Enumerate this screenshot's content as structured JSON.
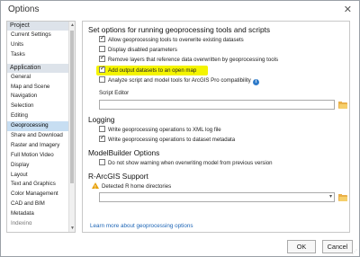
{
  "window": {
    "title": "Options",
    "close_glyph": "✕"
  },
  "sidebar": {
    "project_header": "Project",
    "project_items": [
      "Current Settings",
      "Units",
      "Tasks"
    ],
    "application_header": "Application",
    "application_items": [
      "General",
      "Map and Scene",
      "Navigation",
      "Selection",
      "Editing",
      "Geoprocessing",
      "Share and Download",
      "Raster and Imagery",
      "Full Motion Video",
      "Display",
      "Layout",
      "Text and Graphics",
      "Color Management",
      "CAD and BIM",
      "Metadata",
      "Indexing"
    ],
    "selected": "Geoprocessing"
  },
  "main": {
    "section1_title": "Set options for running geoprocessing tools and scripts",
    "options": [
      {
        "label": "Allow geoprocessing tools to overwrite existing datasets",
        "checked": true
      },
      {
        "label": "Display disabled parameters",
        "checked": false
      },
      {
        "label": "Remove layers that reference data overwritten by geoprocessing tools",
        "checked": true
      },
      {
        "label": "Add output datasets to an open map",
        "checked": true,
        "highlighted": true
      },
      {
        "label": "Analyze script and model tools for ArcGIS Pro compatibility",
        "checked": false,
        "info": true
      }
    ],
    "script_editor_label": "Script Editor",
    "script_editor_value": "",
    "logging_title": "Logging",
    "logging_options": [
      {
        "label": "Write geoprocessing operations to XML log file",
        "checked": false
      },
      {
        "label": "Write geoprocessing operations to dataset metadata",
        "checked": true
      }
    ],
    "modelbuilder_title": "ModelBuilder Options",
    "modelbuilder_option": {
      "label": "Do not show warning when overwriting model from previous version",
      "checked": false
    },
    "rarcgis_title": "R-ArcGIS Support",
    "r_home_label": "Detected R home directories",
    "r_home_value": "",
    "learn_link": "Learn more about geoprocessing options"
  },
  "buttons": {
    "ok": "OK",
    "cancel": "Cancel"
  },
  "colors": {
    "highlight": "#f4f400",
    "selected_bg": "#c7def2",
    "link": "#1c64b5",
    "info": "#2f7bc9",
    "warning": "#e8a20c"
  }
}
